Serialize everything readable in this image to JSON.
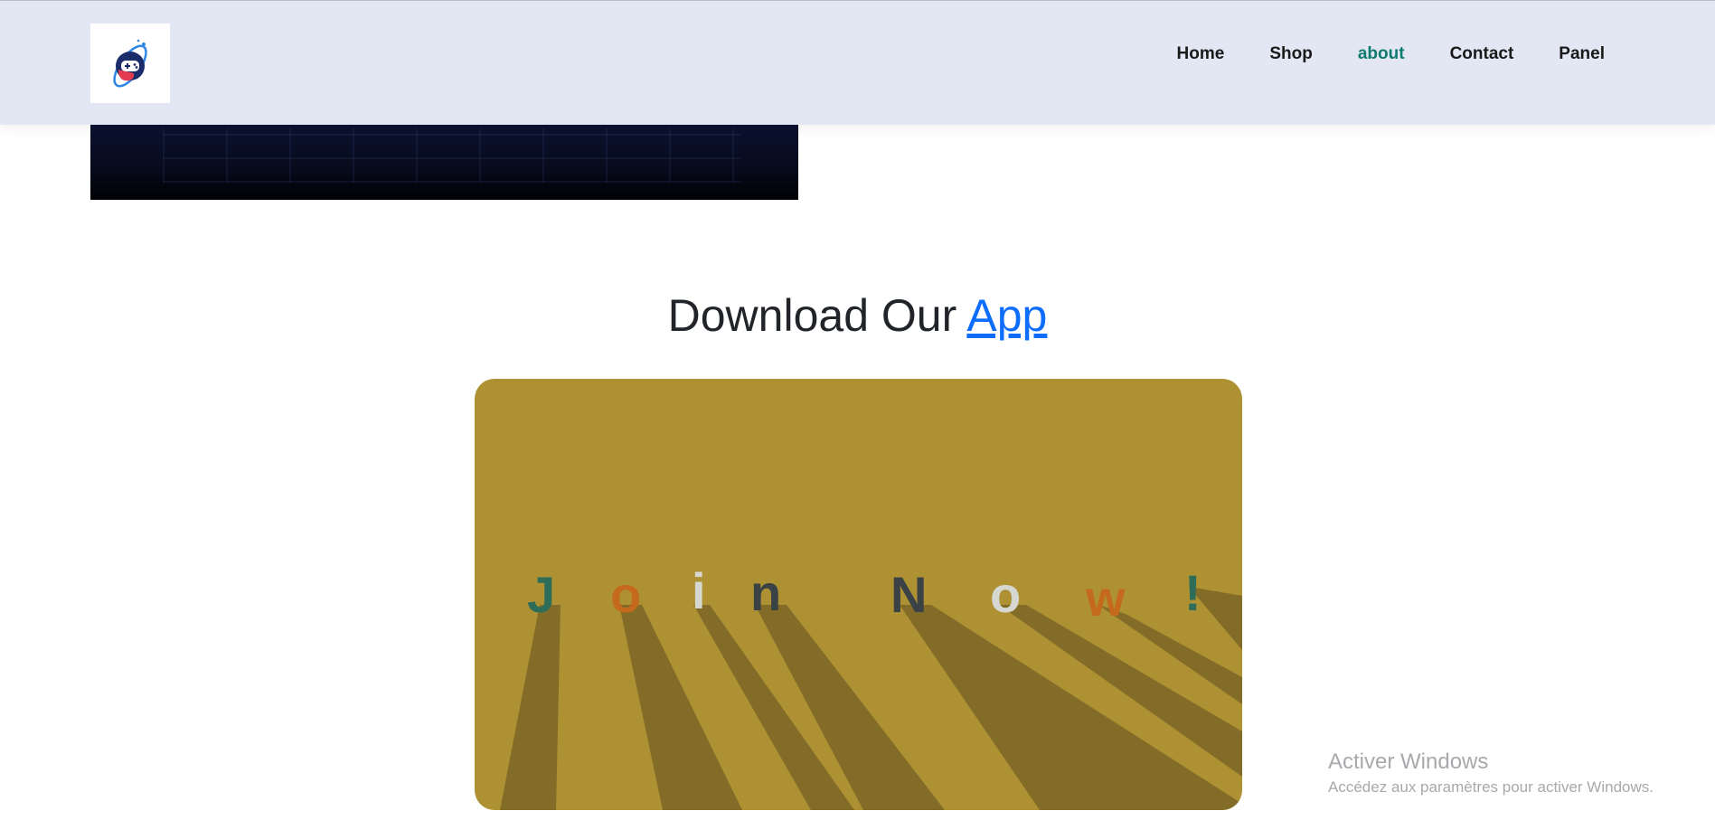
{
  "nav": {
    "logo_icon": "gamepad-planet-logo",
    "links": [
      {
        "label": "Home"
      },
      {
        "label": "Shop"
      },
      {
        "label": "about",
        "active": true
      },
      {
        "label": "Contact"
      },
      {
        "label": "Panel"
      }
    ],
    "active_color": "#0f7a6f"
  },
  "download": {
    "title_prefix": "Download Our",
    "title_link": "App",
    "link_color": "#0d6efd"
  },
  "promo": {
    "letters": [
      "J",
      "o",
      "i",
      "n",
      "N",
      "o",
      "w",
      "!"
    ],
    "background": "#ad9133"
  },
  "watermark": {
    "title": "Activer Windows",
    "subtitle": "Accédez aux paramètres pour activer Windows."
  }
}
